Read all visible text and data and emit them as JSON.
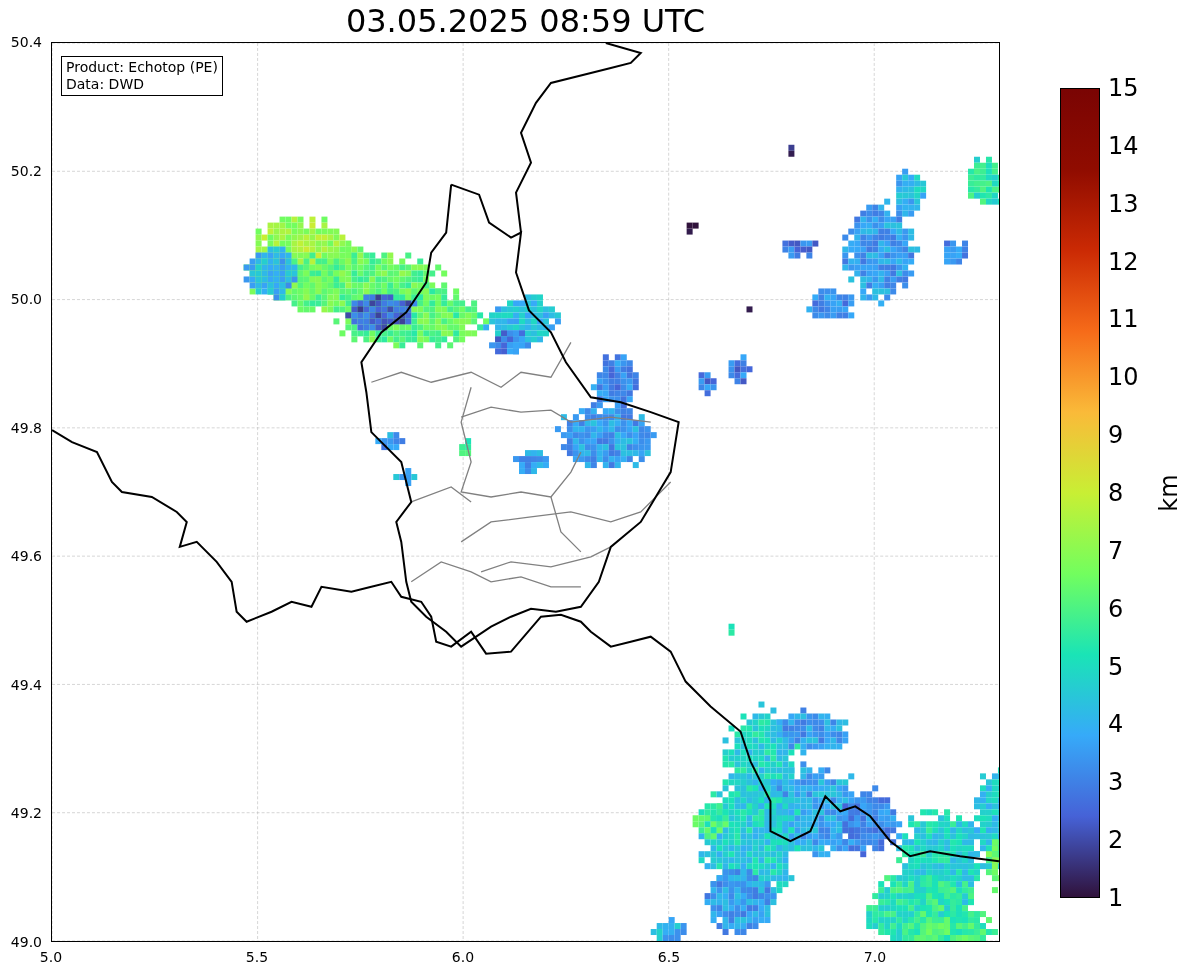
{
  "title": "03.05.2025 08:59 UTC",
  "info_box": {
    "lines": [
      "Product: Echotop (PE)",
      "Data: DWD"
    ]
  },
  "x_axis": {
    "ticks": [
      "5.0",
      "5.5",
      "6.0",
      "6.5",
      "7.0"
    ]
  },
  "y_axis": {
    "ticks": [
      "50.4",
      "50.2",
      "50.0",
      "49.8",
      "49.6",
      "49.4",
      "49.2",
      "49.0"
    ]
  },
  "colorbar": {
    "label": "km",
    "ticks": [
      "15",
      "14",
      "13",
      "12",
      "11",
      "10",
      "9",
      "8",
      "7",
      "6",
      "5",
      "4",
      "3",
      "2",
      "1"
    ]
  }
}
